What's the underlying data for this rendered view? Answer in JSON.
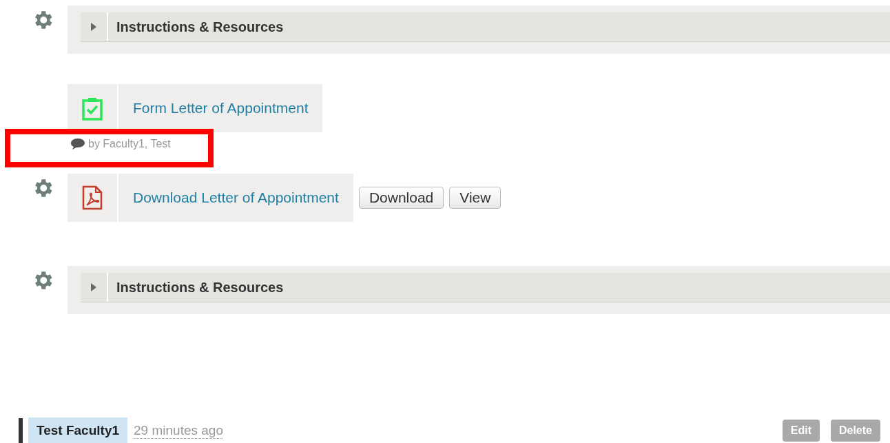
{
  "items": [
    {
      "kind": "folder",
      "title": "Instructions & Resources",
      "expanded": false,
      "has_settings": true
    },
    {
      "kind": "form",
      "title": "Form Letter of Appointment",
      "has_settings": false,
      "meta": "by Faculty1, Test",
      "highlighted": true
    },
    {
      "kind": "file",
      "title": "Download Letter of Appointment",
      "has_settings": true,
      "buttons": [
        "Download",
        "View"
      ]
    },
    {
      "kind": "folder",
      "title": "Instructions & Resources",
      "expanded": false,
      "has_settings": true
    }
  ],
  "comment": {
    "author": "Test Faculty1",
    "time": "29 minutes ago",
    "buttons": [
      {
        "label": "Edit",
        "disabled": true
      },
      {
        "label": "Delete",
        "disabled": true
      }
    ]
  }
}
